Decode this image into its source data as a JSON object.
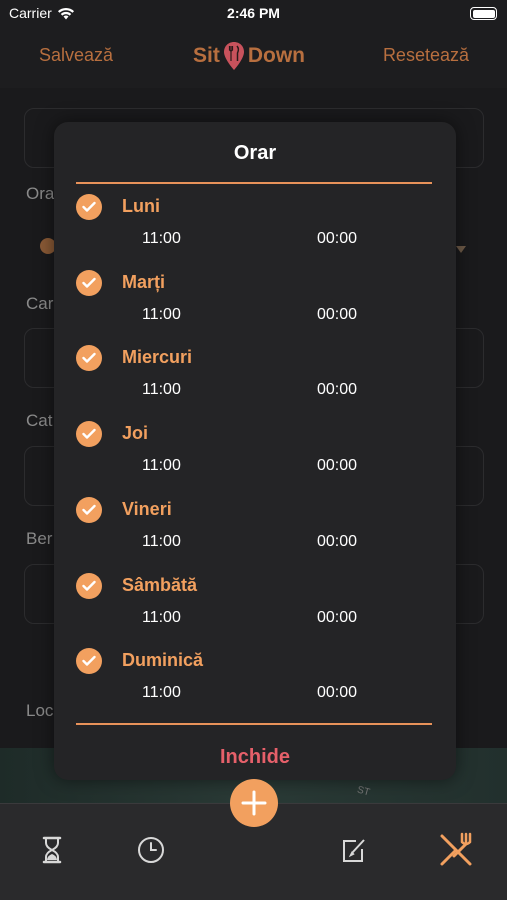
{
  "status": {
    "carrier": "Carrier",
    "time": "2:46 PM"
  },
  "nav": {
    "left_label": "Salvează",
    "right_label": "Resetează",
    "logo_left": "Sit",
    "logo_right": "Down"
  },
  "background": {
    "labels": [
      "Ora",
      "Car",
      "Cat",
      "Ber",
      "Loc"
    ],
    "street": "ST"
  },
  "modal": {
    "title": "Orar",
    "close_label": "Inchide",
    "days": [
      {
        "name": "Luni",
        "open": "11:00",
        "close": "00:00",
        "checked": true
      },
      {
        "name": "Marți",
        "open": "11:00",
        "close": "00:00",
        "checked": true
      },
      {
        "name": "Miercuri",
        "open": "11:00",
        "close": "00:00",
        "checked": true
      },
      {
        "name": "Joi",
        "open": "11:00",
        "close": "00:00",
        "checked": true
      },
      {
        "name": "Vineri",
        "open": "11:00",
        "close": "00:00",
        "checked": true
      },
      {
        "name": "Sâmbătă",
        "open": "11:00",
        "close": "00:00",
        "checked": true
      },
      {
        "name": "Duminică",
        "open": "11:00",
        "close": "00:00",
        "checked": true
      }
    ]
  },
  "tabbar": {
    "items": [
      {
        "icon": "hourglass-icon"
      },
      {
        "icon": "clock-icon"
      },
      {
        "icon": "edit-icon"
      },
      {
        "icon": "cutlery-icon",
        "active": true
      }
    ],
    "fab_icon": "plus-icon"
  },
  "colors": {
    "accent": "#f2a05f",
    "nav_text": "#b86f3f",
    "close": "#e6606a",
    "background": "#1d1d1f"
  }
}
